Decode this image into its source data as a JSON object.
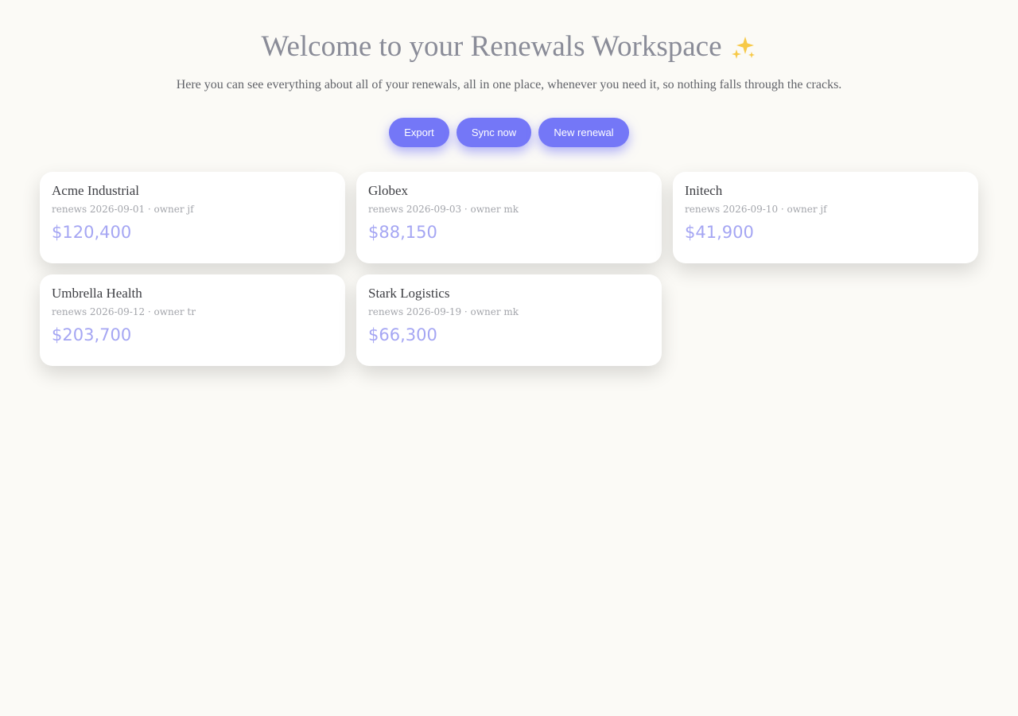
{
  "header": {
    "title": "Welcome to your Renewals Workspace",
    "sparkle_icon": "sparkles-icon",
    "subtitle": "Here you can see everything about all of your renewals, all in one place, whenever you need it, so nothing falls through the cracks."
  },
  "actions": {
    "export_label": "Export",
    "sync_label": "Sync now",
    "new_label": "New renewal"
  },
  "colors": {
    "accent": "#7477f7",
    "amount": "#a5a6f3",
    "background": "#fbfaf6"
  },
  "renewals": [
    {
      "name": "Acme Industrial",
      "meta": "renews 2026-09-01 · owner jf",
      "amount": "$120,400"
    },
    {
      "name": "Globex",
      "meta": "renews 2026-09-03 · owner mk",
      "amount": "$88,150"
    },
    {
      "name": "Initech",
      "meta": "renews 2026-09-10 · owner jf",
      "amount": "$41,900"
    },
    {
      "name": "Umbrella Health",
      "meta": "renews 2026-09-12 · owner tr",
      "amount": "$203,700"
    },
    {
      "name": "Stark Logistics",
      "meta": "renews 2026-09-19 · owner mk",
      "amount": "$66,300"
    }
  ]
}
